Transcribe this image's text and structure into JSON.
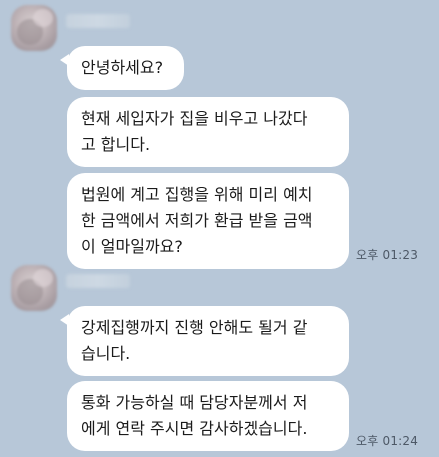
{
  "conversation": {
    "groups": [
      {
        "sender": {
          "avatar_icon": "blurred-profile-avatar",
          "name": ""
        },
        "messages": [
          "안녕하세요?",
          "현재 세입자가 집을 비우고 나갔다\n고 합니다.",
          "법원에 계고 집행을 위해 미리 예치\n한 금액에서 저희가 환급 받을 금액\n이 얼마일까요?"
        ],
        "time": "오후 01:23"
      },
      {
        "sender": {
          "avatar_icon": "blurred-profile-avatar",
          "name": ""
        },
        "messages": [
          "강제집행까지 진행 안해도 될거 같\n습니다.",
          "통화 가능하실 때 담당자분께서 저\n에게 연락 주시면 감사하겠습니다."
        ],
        "time": "오후 01:24"
      }
    ]
  },
  "colors": {
    "background": "#b7c7d8",
    "bubble": "#ffffff",
    "text": "#1b1b1b",
    "timestamp": "#4d5866"
  }
}
